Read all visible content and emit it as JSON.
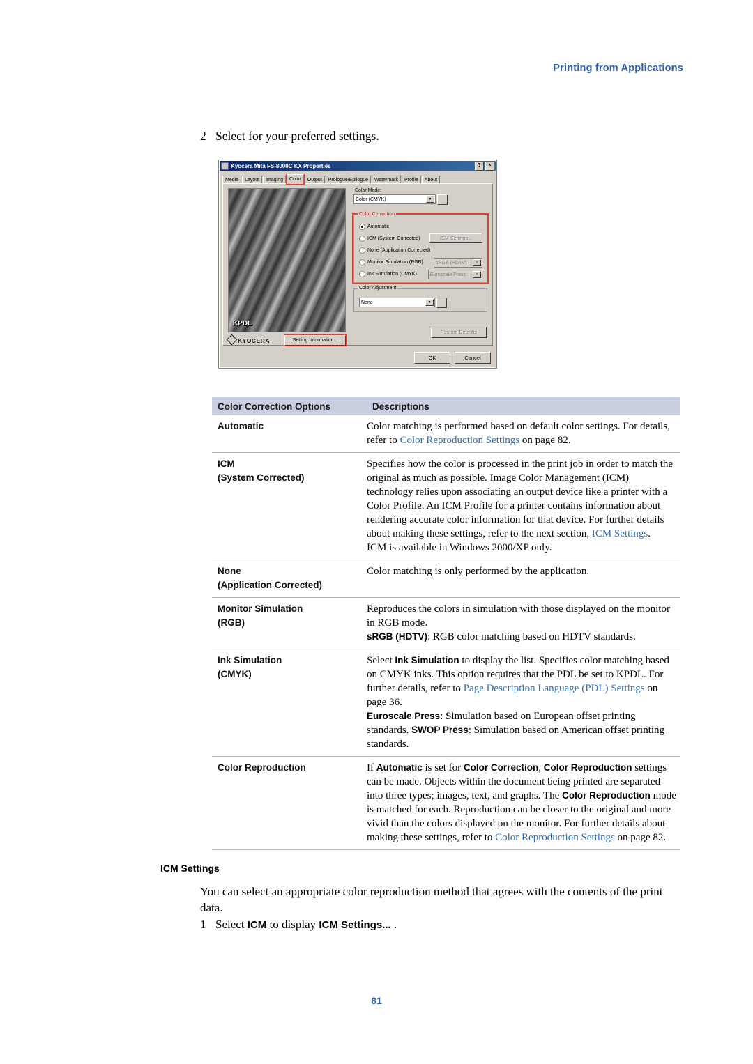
{
  "header": {
    "running_head": "Printing from Applications"
  },
  "step_line": {
    "num": "2",
    "text": "Select for your preferred settings."
  },
  "dialog": {
    "title": "Kyocera Mita FS-8000C KX Properties",
    "help_btn": "?",
    "close_btn": "×",
    "tabs": [
      "Media",
      "Layout",
      "Imaging",
      "Color",
      "Output",
      "Prologue/Epilogue",
      "Watermark",
      "Profile",
      "About"
    ],
    "active_tab": "Color",
    "color_mode_label": "Color Mode:",
    "color_mode_value": "Color (CMYK)",
    "color_correction_label": "Color Correction",
    "radios": [
      {
        "label": "Automatic",
        "selected": true
      },
      {
        "label": "ICM (System Corrected)",
        "selected": false
      },
      {
        "label": "None (Application Corrected)",
        "selected": false
      },
      {
        "label": "Monitor Simulation (RGB)",
        "selected": false
      },
      {
        "label": "Ink Simulation (CMYK)",
        "selected": false
      }
    ],
    "icm_settings_button": "ICM Settings...",
    "monitor_sim_value": "sRGB (HDTV)",
    "ink_sim_value": "Euroscale Press",
    "color_adjustment_label": "Color Adjustment",
    "color_adjustment_value": "None",
    "preview_label": "KPDL",
    "logo_text": "KYOCERA",
    "setting_information_button": "Setting Information...",
    "restore_defaults_button": "Restore Defaults",
    "ok_button": "OK",
    "cancel_button": "Cancel"
  },
  "table": {
    "headers": {
      "col1": "Color Correction Options",
      "col2": "Descriptions"
    },
    "rows": [
      {
        "name": "Automatic",
        "sub": "",
        "desc_html": "Color matching is performed based on default color settings. For details, refer to <span class=\"lnk\">Color Reproduction Settings</span> on page 82."
      },
      {
        "name": "ICM",
        "sub": "(System Corrected)",
        "desc_html": "Specifies how the color is processed in the print job in order to match the original as much as possible. Image Color Management (ICM) technology relies upon associating an output device like a printer with a Color Profile. An ICM Profile for a printer contains information about rendering accurate color information for that device. For further details about making these settings, refer to the next section, <span class=\"lnk\">ICM Settings</span>.<br>ICM is available in Windows 2000/XP only."
      },
      {
        "name": "None",
        "sub": "(Application Corrected)",
        "desc_html": "Color matching is only performed by the application."
      },
      {
        "name": "Monitor Simulation",
        "sub": "(RGB)",
        "desc_html": "Reproduces the colors in simulation with those displayed on the monitor in RGB mode.<br><span class=\"bld\">sRGB (HDTV)</span>: RGB color matching based on HDTV standards."
      },
      {
        "name": "Ink Simulation",
        "sub": "(CMYK)",
        "desc_html": "Select <span class=\"bld\">Ink Simulation</span> to display the list. Specifies color matching based on CMYK inks. This option requires that the PDL be set to KPDL. For further details, refer to <span class=\"lnk\">Page Description Language (PDL) Settings</span> on page 36.<br><span class=\"bld\">Euroscale Press</span>: Simulation based on European offset printing standards. <span class=\"bld\">SWOP Press</span>: Simulation based on American offset printing standards."
      },
      {
        "name": "Color Reproduction",
        "sub": "",
        "desc_html": "If <span class=\"bld\">Automatic</span> is set for <span class=\"bld\">Color Correction</span>, <span class=\"bld\">Color Reproduction</span> settings can be made. Objects within the document being printed are separated into three types; images, text, and graphs. The <span class=\"bld\">Color Reproduction</span> mode is matched for each. Reproduction can be closer to the original and more vivid than the colors displayed on the monitor. For further details about making these settings, refer to <span class=\"lnk\">Color Reproduction Settings</span> on page 82."
      }
    ]
  },
  "icm_section": {
    "heading": "ICM Settings",
    "paragraph": "You can select an appropriate color reproduction method that agrees with the contents of the print data.",
    "step_num": "1",
    "step_html": "Select <span class=\"sans-b\">ICM</span> to display <span class=\"sans-b\">ICM Settings...</span> ."
  },
  "page_number": "81"
}
